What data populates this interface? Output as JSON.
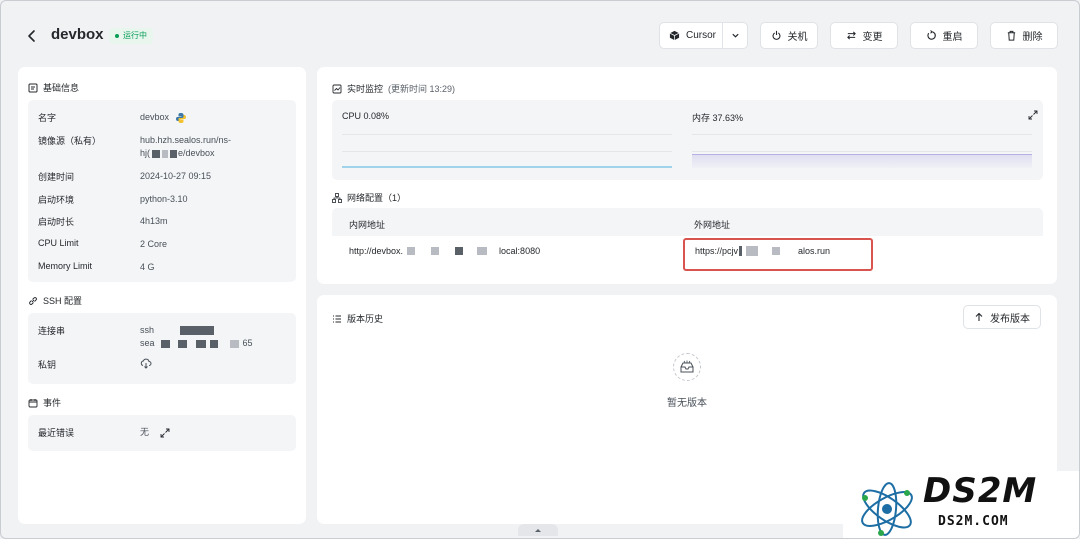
{
  "header": {
    "title": "devbox",
    "status": "运行中",
    "ide_label": "Cursor",
    "buttons": {
      "shutdown": "关机",
      "change": "变更",
      "restart": "重启",
      "delete": "删除"
    }
  },
  "basic_info": {
    "title": "基础信息",
    "rows": [
      {
        "label": "名字",
        "value": "devbox"
      },
      {
        "label": "镜像源（私有）",
        "value_line1": "hub.hzh.sealos.run/ns-",
        "value_line2_prefix": "hj(",
        "value_line2_suffix": "e/devbox"
      },
      {
        "label": "创建时间",
        "value": "2024-10-27 09:15"
      },
      {
        "label": "启动环境",
        "value": "python-3.10"
      },
      {
        "label": "启动时长",
        "value": "4h13m"
      },
      {
        "label": "CPU Limit",
        "value": "2 Core"
      },
      {
        "label": "Memory Limit",
        "value": "4 G"
      }
    ]
  },
  "ssh": {
    "title": "SSH 配置",
    "connection_label": "连接串",
    "connection_line1": "ssh",
    "connection_line2_prefix": "sea",
    "connection_line2_suffix": "65",
    "private_key_label": "私钥"
  },
  "events": {
    "title": "事件",
    "last_error_label": "最近错误",
    "last_error_value": "无"
  },
  "monitor": {
    "title": "实时监控",
    "updated": "(更新时间  13:29)",
    "cpu": "CPU 0.08%",
    "memory": "内存 37.63%",
    "cpu_fraction": 0.0008,
    "memory_fraction": 0.3763,
    "cpu_color": "#9fd3ec",
    "memory_color": "#b7b2e6"
  },
  "network": {
    "title": "网络配置（1）",
    "internal_header": "内网地址",
    "external_header": "外网地址",
    "internal_prefix": "http://devbox.",
    "internal_suffix": "local:8080",
    "external_prefix": "https://pcjv",
    "external_suffix": "alos.run"
  },
  "history": {
    "title": "版本历史",
    "publish_button": "发布版本",
    "empty": "暂无版本"
  },
  "watermark": {
    "big": "DS2M",
    "small": "DS2M.COM"
  },
  "colors": {
    "status_green": "#0a9d56",
    "highlight_red": "#d9534f"
  }
}
